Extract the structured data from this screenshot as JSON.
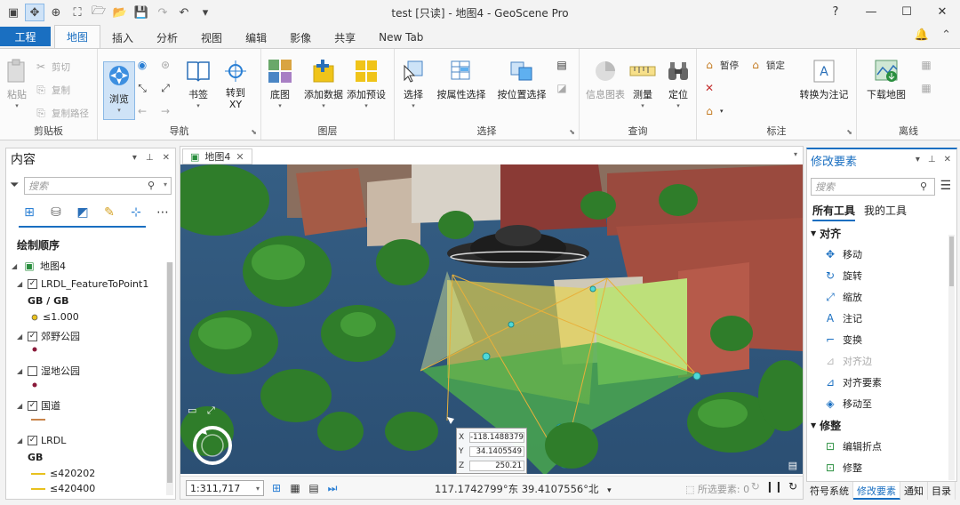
{
  "window": {
    "title": "test [只读] - 地图4 - GeoScene Pro",
    "help": "?",
    "minimize": "—",
    "maximize": "☐",
    "close": "✕"
  },
  "tabs": [
    {
      "label": "工程"
    },
    {
      "label": "地图"
    },
    {
      "label": "插入"
    },
    {
      "label": "分析"
    },
    {
      "label": "视图"
    },
    {
      "label": "编辑"
    },
    {
      "label": "影像"
    },
    {
      "label": "共享"
    },
    {
      "label": "New Tab"
    }
  ],
  "ribbon": {
    "clipboard": {
      "label": "剪贴板",
      "paste": "粘贴",
      "cut": "剪切",
      "copy": "复制",
      "copy_path": "复制路径"
    },
    "navigate": {
      "label": "导航",
      "explore": "浏览",
      "bookmarks": "书签",
      "goto_xy": "转到\nXY"
    },
    "layer": {
      "label": "图层",
      "basemap": "底图",
      "add_data": "添加数据",
      "add_preset": "添加预设"
    },
    "selection": {
      "label": "选择",
      "select": "选择",
      "by_attr": "按属性选择",
      "by_loc": "按位置选择"
    },
    "inquiry": {
      "label": "查询",
      "infographics": "信息图表",
      "measure": "测量",
      "locate": "定位"
    },
    "labeling": {
      "label": "标注",
      "pause": "暂停",
      "lock": "锁定",
      "convert": "转换为注记"
    },
    "offline": {
      "label": "离线",
      "download_map": "下载地图"
    }
  },
  "contents": {
    "title": "内容",
    "search_placeholder": "搜索",
    "drawing_order": "绘制顺序",
    "map_name": "地图4",
    "layers": [
      {
        "name": "LRDL_FeatureToPoint1",
        "checked": true,
        "legend_title": "GB / GB",
        "legend": [
          {
            "label": "≤1.000",
            "color": "#e8c11e",
            "shape": "dot"
          }
        ]
      },
      {
        "name": "郊野公园",
        "checked": true,
        "legend": [
          {
            "label": "",
            "color": "#8a1a3a",
            "shape": "dot"
          }
        ]
      },
      {
        "name": "湿地公园",
        "checked": false,
        "legend": [
          {
            "label": "",
            "color": "#8a1a3a",
            "shape": "dot"
          }
        ]
      },
      {
        "name": "国道",
        "checked": true,
        "legend": [
          {
            "label": "",
            "color": "#c8844a",
            "shape": "line"
          }
        ]
      },
      {
        "name": "LRDL",
        "checked": true,
        "legend_title": "GB",
        "legend": [
          {
            "label": "≤420202",
            "color": "#e8c11e",
            "shape": "line"
          },
          {
            "label": "≤420400",
            "color": "#e8c11e",
            "shape": "line"
          }
        ]
      }
    ]
  },
  "map": {
    "tab_label": "地图4",
    "scale": "1:311,717",
    "coordinates": "117.1742799°东 39.4107556°北",
    "selected_features": "所选要素: 0",
    "xyz": {
      "x": "-118.1488379",
      "y": "34.1405549",
      "z": "250.21"
    }
  },
  "modify": {
    "title": "修改要素",
    "search_placeholder": "搜索",
    "subtabs": [
      "所有工具",
      "我的工具"
    ],
    "align_section": "对齐",
    "align_tools": [
      {
        "label": "移动",
        "enabled": true
      },
      {
        "label": "旋转",
        "enabled": true
      },
      {
        "label": "缩放",
        "enabled": true
      },
      {
        "label": "注记",
        "enabled": true
      },
      {
        "label": "变换",
        "enabled": true
      },
      {
        "label": "对齐边",
        "enabled": false
      },
      {
        "label": "对齐要素",
        "enabled": true
      },
      {
        "label": "移动至",
        "enabled": true
      }
    ],
    "reshape_section": "修整",
    "reshape_tools": [
      {
        "label": "编辑折点",
        "enabled": true
      },
      {
        "label": "修整",
        "enabled": true
      }
    ]
  },
  "bottom_tabs": [
    "符号系统",
    "修改要素",
    "通知",
    "目录"
  ]
}
